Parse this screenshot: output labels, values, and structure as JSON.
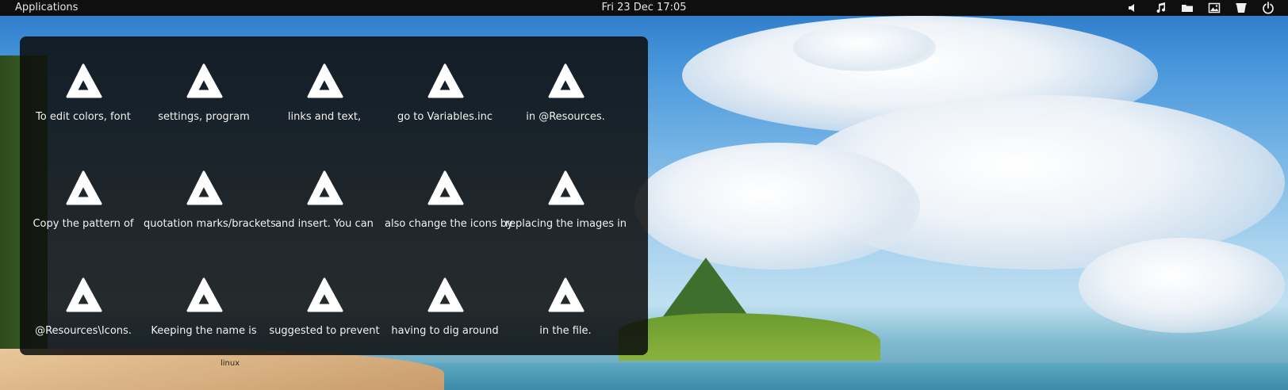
{
  "topbar": {
    "apps_label": "Applications",
    "clock": "Fri 23 Dec 17:05",
    "tray_icons": [
      "volume-icon",
      "music-icon",
      "folder-icon",
      "image-icon",
      "trash-icon",
      "power-icon"
    ]
  },
  "launcher": {
    "rows": [
      [
        "To edit colors, font",
        "settings, program",
        "links and text,",
        "go to Variables.inc",
        "in @Resources."
      ],
      [
        "Copy the pattern of",
        "quotation marks/brackets",
        "and insert. You can",
        "also change the icons by",
        "replacing the images in"
      ],
      [
        "@Resources\\Icons.",
        "Keeping the name is",
        "suggested to prevent",
        "having to dig around",
        "in the file."
      ]
    ]
  },
  "desktop": {
    "label": "linux"
  },
  "colors": {
    "panel_bg": "#0f0f10",
    "launcher_bg": "#0c0c0c",
    "icon_color": "#ffffff",
    "text_color": "#f2f2f2"
  }
}
